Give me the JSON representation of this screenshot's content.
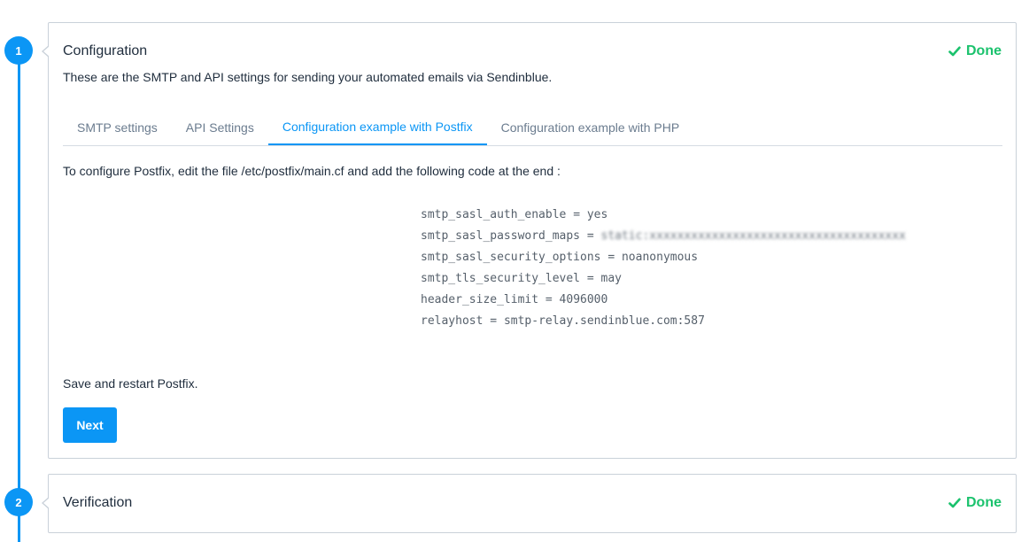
{
  "steps": [
    {
      "number": "1",
      "title": "Configuration",
      "status": "Done",
      "subtitle": "These are the SMTP and API settings for sending your automated emails via Sendinblue.",
      "tabs": [
        {
          "label": "SMTP settings",
          "active": false
        },
        {
          "label": "API Settings",
          "active": false
        },
        {
          "label": "Configuration example with Postfix",
          "active": true
        },
        {
          "label": "Configuration example with PHP",
          "active": false
        }
      ],
      "instruction": "To configure Postfix, edit the file /etc/postfix/main.cf and add the following code at the end :",
      "code_lines": [
        {
          "key": "smtp_sasl_auth_enable",
          "value": "yes"
        },
        {
          "key": "smtp_sasl_password_maps",
          "value": "static:xxxxxxxxxxxxxxxxxxxxxxxxxxxxxxxxxxxxx"
        },
        {
          "key": "smtp_sasl_security_options",
          "value": "noanonymous"
        },
        {
          "key": "smtp_tls_security_level",
          "value": "may"
        },
        {
          "key": "header_size_limit",
          "value": "4096000"
        },
        {
          "key": "relayhost",
          "value": "smtp-relay.sendinblue.com:587"
        }
      ],
      "save_text": "Save and restart Postfix.",
      "next_label": "Next"
    },
    {
      "number": "2",
      "title": "Verification",
      "status": "Done"
    }
  ],
  "colors": {
    "accent": "#0b96f5",
    "done": "#1bc26d",
    "border": "#c9d1d9"
  },
  "icons": {
    "done": "checkmark-icon"
  }
}
